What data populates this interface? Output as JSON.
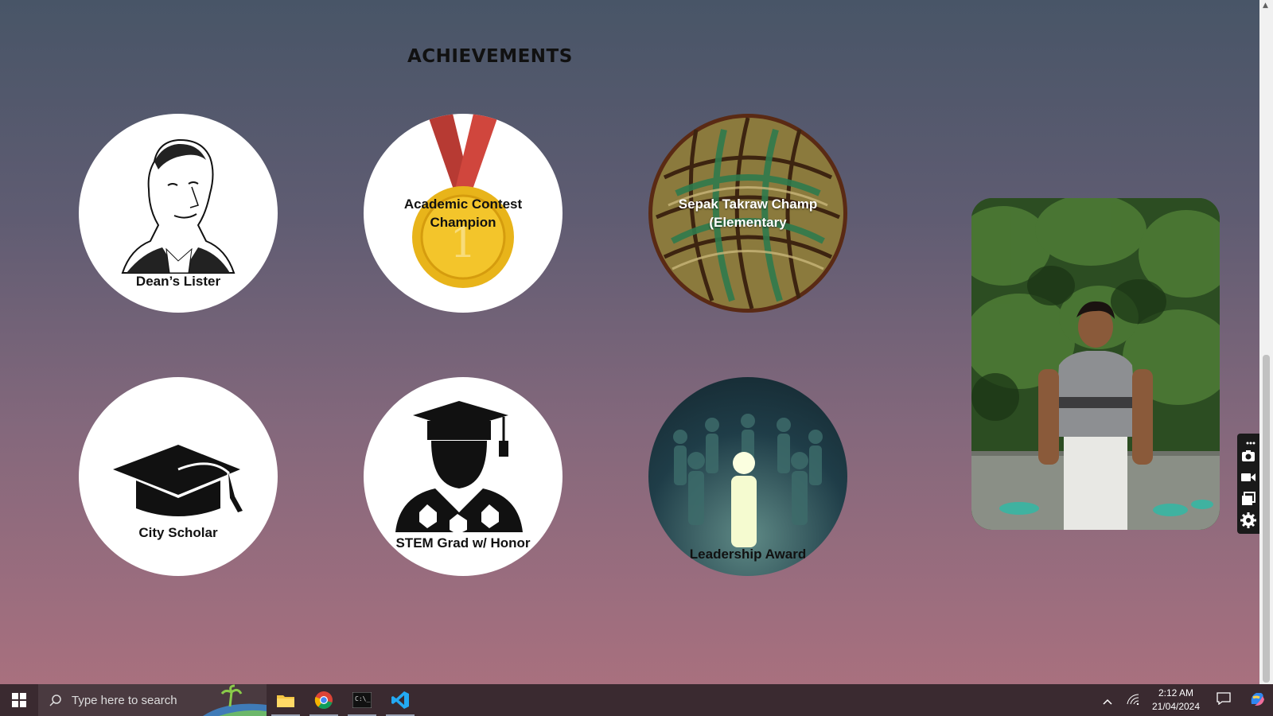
{
  "page": {
    "title": "ACHIEVEMENTS"
  },
  "achievements": [
    {
      "label": "Dean’s Lister",
      "icon": "scholar-portrait-icon"
    },
    {
      "label_line1": "Academic Contest",
      "label_line2": "Champion",
      "icon": "gold-medal-icon"
    },
    {
      "label_line1": "Sepak Takraw Champ",
      "label_line2": "(Elementary",
      "icon": "takraw-ball-icon"
    },
    {
      "label": "City Scholar",
      "icon": "graduation-cap-icon"
    },
    {
      "label": "STEM Grad w/ Honor",
      "icon": "graduate-icon"
    },
    {
      "label": "Leadership Award",
      "icon": "leadership-crowd-icon"
    }
  ],
  "taskbar": {
    "search_placeholder": "Type here to search",
    "time": "2:12 AM",
    "date": "21/04/2024"
  },
  "colors": {
    "background_top": "#485567",
    "background_bottom": "#ad717f",
    "taskbar": "#3a2a30"
  }
}
